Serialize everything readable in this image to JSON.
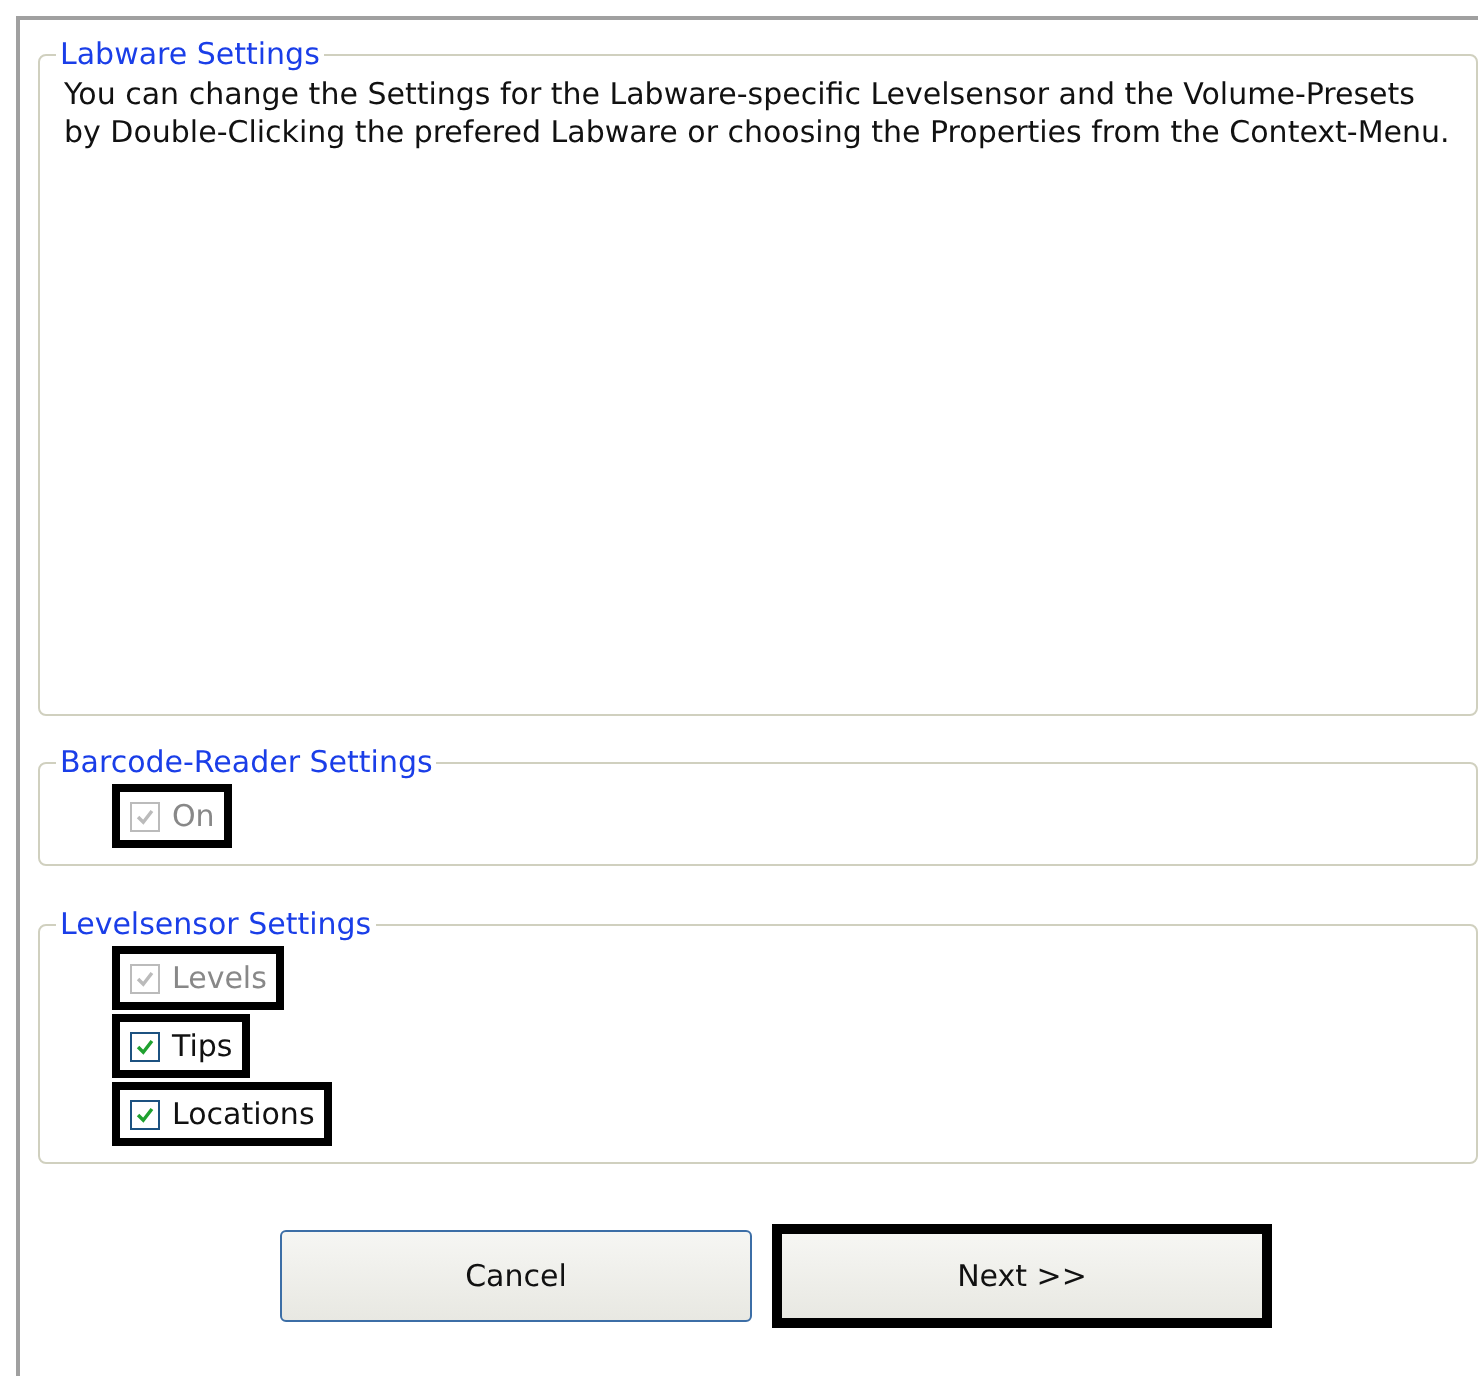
{
  "groups": [
    {
      "title": "Labware Settings",
      "kind": "text",
      "text": "You can change the Settings for the Labware-specific Levelsensor and the Volume-Presets by Double-Clicking the prefered Labware or choosing the Properties from the Context-Menu."
    },
    {
      "title": "Barcode-Reader Settings",
      "kind": "checks",
      "options": [
        {
          "label": "On",
          "checked": true,
          "disabled": true,
          "highlighted": true
        }
      ]
    },
    {
      "title": "Levelsensor Settings",
      "kind": "checks",
      "options": [
        {
          "label": "Levels",
          "checked": true,
          "disabled": true,
          "highlighted": true
        },
        {
          "label": "Tips",
          "checked": true,
          "disabled": false,
          "highlighted": true
        },
        {
          "label": "Locations",
          "checked": true,
          "disabled": false,
          "highlighted": true
        }
      ]
    }
  ],
  "buttons": [
    {
      "label": "Cancel",
      "highlighted": false
    },
    {
      "label": "Next >>",
      "highlighted": true
    }
  ]
}
